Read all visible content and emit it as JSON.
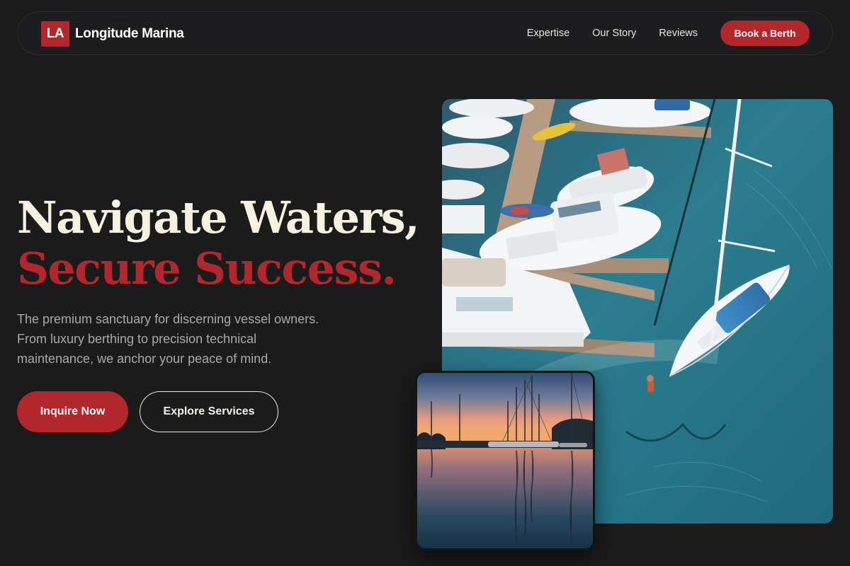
{
  "brand": {
    "logo_text": "LA",
    "name": "Longitude Marina"
  },
  "nav": {
    "links": [
      "Expertise",
      "Our Story",
      "Reviews"
    ],
    "cta_label": "Book a Berth"
  },
  "hero": {
    "headline_line1": "Navigate Waters,",
    "headline_line2": "Secure Success.",
    "lede": "The premium sanctuary for discerning vessel owners. From luxury berthing to precision technical maintenance, we anchor your peace of mind.",
    "primary_cta": "Inquire Now",
    "secondary_cta": "Explore Services"
  },
  "images": {
    "main": "aerial-marina-photo",
    "inset": "sunset-harbor-photo"
  },
  "colors": {
    "background": "#1b1b1c",
    "accent": "#b3262b",
    "headline": "#f6f2df",
    "body_text": "#a9a9ad"
  }
}
